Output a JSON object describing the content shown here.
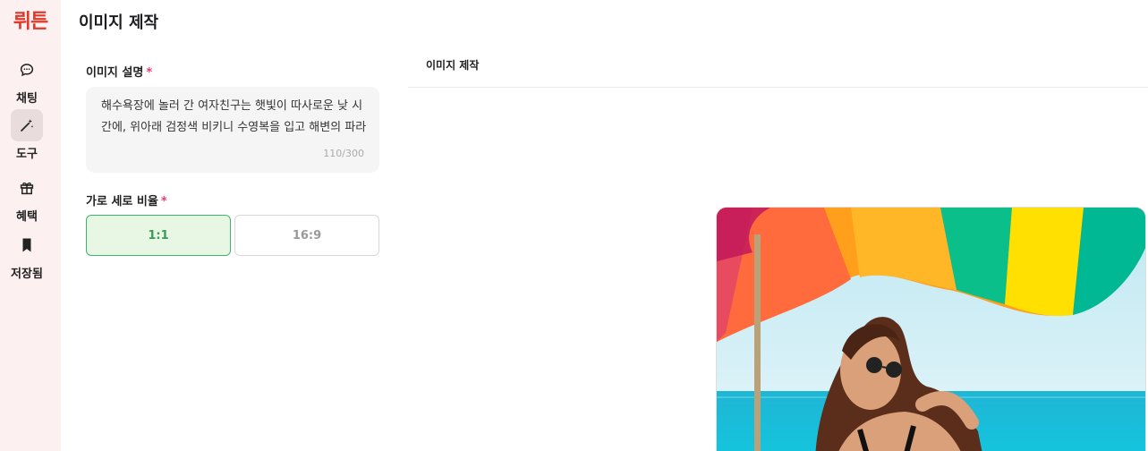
{
  "app": {
    "logo": "뤼튼"
  },
  "sidebar": {
    "items": [
      {
        "label": "채팅",
        "icon": "chat-bubble-icon",
        "active": false
      },
      {
        "label": "도구",
        "icon": "magic-wand-icon",
        "active": true
      },
      {
        "label": "혜택",
        "icon": "gift-icon",
        "active": false
      },
      {
        "label": "저장됨",
        "icon": "bookmark-icon",
        "active": false
      }
    ]
  },
  "header": {
    "title": "이미지 제작"
  },
  "form": {
    "description": {
      "label": "이미지 설명",
      "required_mark": "*",
      "value": "해수욕장에 놀러 간 여자친구는 햇빛이 따사로운 낮 시간에, 위아래 검정색 비키니 수영복을 입고 해변의 파라",
      "counter": "110/300"
    },
    "ratio": {
      "label": "가로 세로 비율",
      "required_mark": "*",
      "options": [
        {
          "label": "1:1",
          "selected": true
        },
        {
          "label": "16:9",
          "selected": false
        }
      ]
    }
  },
  "result_panel": {
    "title": "이미지 제작",
    "image": {
      "subject": "woman in sunglasses under colorful beach umbrella by the sea"
    }
  },
  "colors": {
    "brand": "#e0392b",
    "sidebar_bg": "#fdf0f1",
    "required": "#e83a7c",
    "selected_border": "#3cb371",
    "selected_bg": "#e8f7e3"
  }
}
